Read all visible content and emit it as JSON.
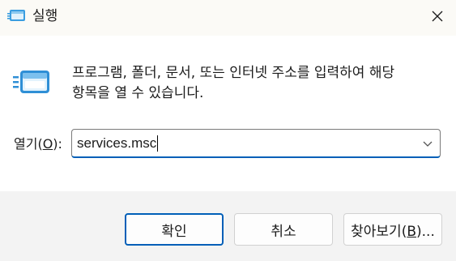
{
  "window": {
    "title": "실행"
  },
  "dialog": {
    "description": "프로그램, 폴더, 문서, 또는 인터넷 주소를 입력하여 해당\n항목을 열 수 있습니다.",
    "open_label_prefix": "열기(",
    "open_label_accel": "O",
    "open_label_suffix": "):",
    "open_value": "services.msc"
  },
  "buttons": {
    "ok": "확인",
    "cancel": "취소",
    "browse_prefix": "찾아보기(",
    "browse_accel": "B",
    "browse_suffix": ")..."
  },
  "icons": {
    "title": "run-app-icon",
    "main": "run-app-icon",
    "close": "close-icon",
    "dropdown": "chevron-down-icon"
  },
  "colors": {
    "accent": "#005fb8",
    "titlebar_bg": "#fbfaf6",
    "footer_bg": "#f3f3f3"
  }
}
